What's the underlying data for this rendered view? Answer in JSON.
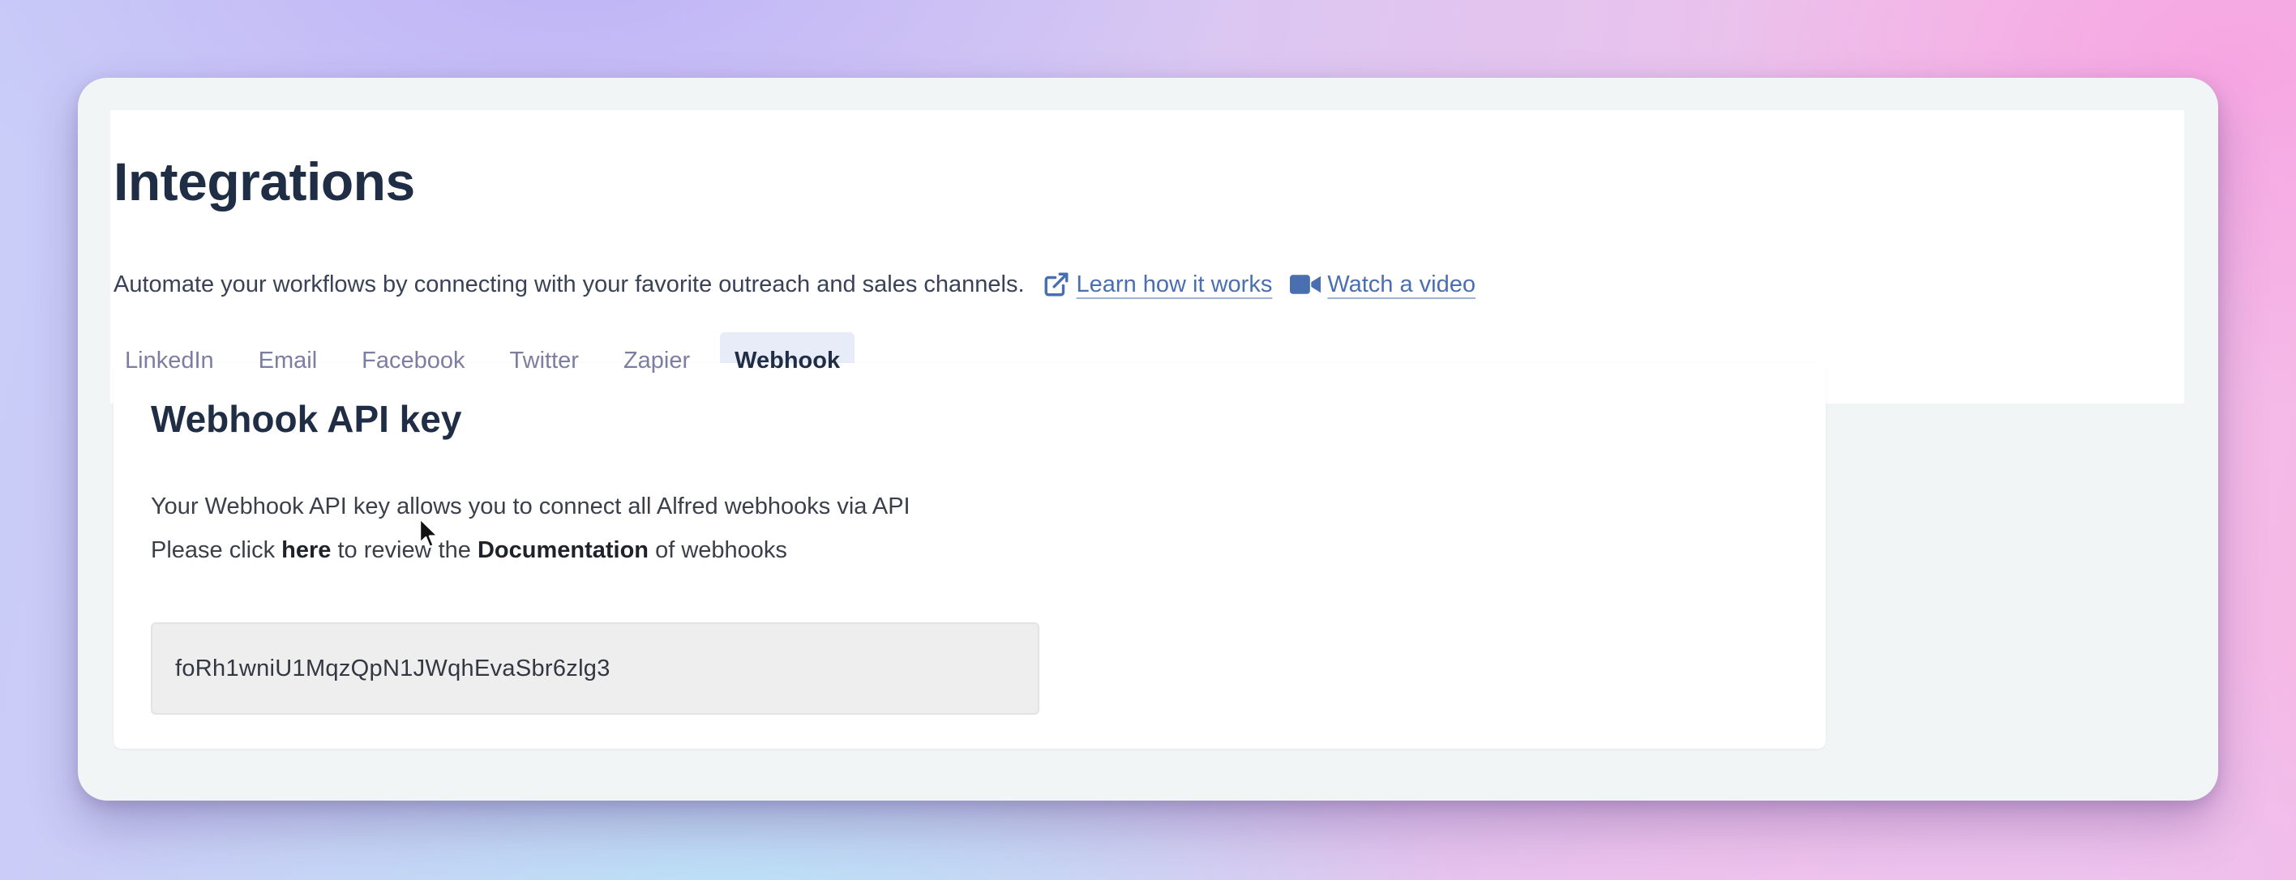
{
  "page": {
    "title": "Integrations",
    "subtitle": "Automate your workflows by connecting with your favorite outreach and sales channels.",
    "links": [
      {
        "label": "Learn how it works",
        "icon": "external-link-icon"
      },
      {
        "label": "Watch a video",
        "icon": "video-camera-icon"
      }
    ]
  },
  "tabs": [
    {
      "label": "LinkedIn",
      "active": false
    },
    {
      "label": "Email",
      "active": false
    },
    {
      "label": "Facebook",
      "active": false
    },
    {
      "label": "Twitter",
      "active": false
    },
    {
      "label": "Zapier",
      "active": false
    },
    {
      "label": "Webhook",
      "active": true
    }
  ],
  "card": {
    "title": "Webhook API key",
    "line1": "Your Webhook API key allows you to connect all Alfred webhooks via API",
    "line2_prefix": "Please click ",
    "line2_here": "here",
    "line2_middle": " to review the ",
    "line2_doc": "Documentation",
    "line2_suffix": " of webhooks",
    "api_key": "foRh1wniU1MqzQpN1JWqhEvaSbr6zlg3"
  },
  "colors": {
    "title": "#1f2d45",
    "link": "#4a6fb0",
    "tab_inactive": "#7b7ea2",
    "tab_active_bg": "#e8ecf8"
  }
}
